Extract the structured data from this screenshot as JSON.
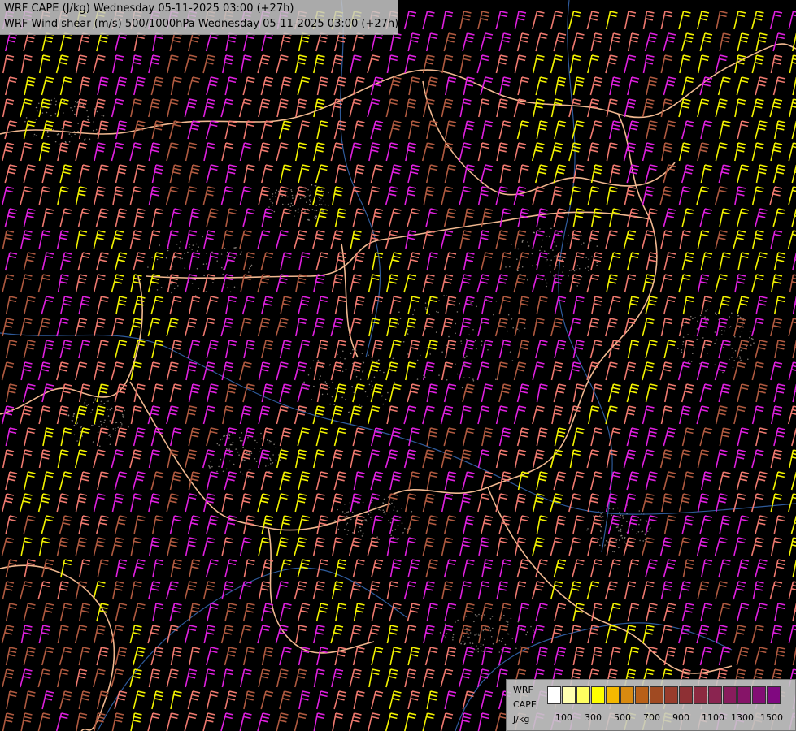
{
  "title": {
    "line1": "WRF CAPE (J/kg) Wednesday 05-11-2025 03:00 (+27h)",
    "line2": "WRF Wind shear (m/s) 500/1000hPa Wednesday 05-11-2025 03:00 (+27h)"
  },
  "legend": {
    "model": "WRF",
    "variable": "CAPE",
    "unit": "J/kg",
    "ticks": [
      "100",
      "300",
      "500",
      "700",
      "900",
      "1100",
      "1300",
      "1500"
    ],
    "swatch_colors": [
      "#ffffff",
      "#ffffb0",
      "#ffff60",
      "#ffff00",
      "#f4b800",
      "#d88a10",
      "#b86018",
      "#a04a22",
      "#983c2c",
      "#8e3034",
      "#8c2a40",
      "#8a2450",
      "#881c5c",
      "#861468",
      "#820e74",
      "#800880"
    ]
  },
  "colors": {
    "background": "#000000",
    "border": "#f0b890",
    "water": "#3a70c0",
    "barb_magenta": "#e020e0",
    "barb_salmon": "#f07a70",
    "barb_yellow": "#f4f400",
    "barb_brown": "#b05a40",
    "cape_stipple": "#b0a8a0"
  },
  "icons": [
    "wind-barb-icon"
  ]
}
